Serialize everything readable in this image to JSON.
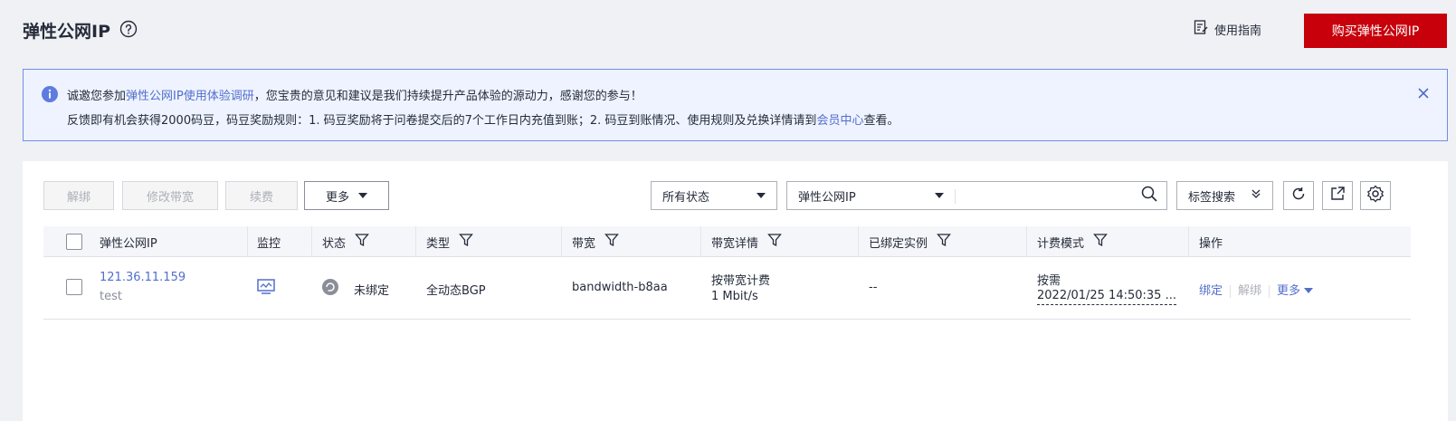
{
  "header": {
    "title": "弹性公网IP",
    "guide_label": "使用指南",
    "buy_label": "购买弹性公网IP"
  },
  "notice": {
    "line1_prefix": "诚邀您参加",
    "line1_link": "弹性公网IP使用体验调研",
    "line1_suffix": "，您宝贵的意见和建议是我们持续提升产品体验的源动力，感谢您的参与！",
    "line2_prefix": "反馈即有机会获得2000码豆，码豆奖励规则：1. 码豆奖励将于问卷提交后的7个工作日内充值到账；2. 码豆到账情况、使用规则及兑换详情请到",
    "line2_link": "会员中心",
    "line2_suffix": "查看。"
  },
  "toolbar": {
    "unbind": "解绑",
    "modify_bandwidth": "修改带宽",
    "renew": "续费",
    "more": "更多",
    "status_filter": "所有状态",
    "search_field": "弹性公网IP",
    "search_value": "",
    "tag_search": "标签搜索"
  },
  "table": {
    "columns": [
      "弹性公网IP",
      "监控",
      "状态",
      "类型",
      "带宽",
      "带宽详情",
      "已绑定实例",
      "计费模式",
      "操作"
    ],
    "rows": [
      {
        "ip": "121.36.11.159",
        "name": "test",
        "status": "未绑定",
        "type": "全动态BGP",
        "bandwidth": "bandwidth-b8aa",
        "bw_billing": "按带宽计费",
        "bw_size": "1 Mbit/s",
        "instance": "--",
        "billing_mode": "按需",
        "billing_time": "2022/01/25 14:50:35 ...",
        "op_bind": "绑定",
        "op_unbind": "解绑",
        "op_more": "更多"
      }
    ]
  },
  "colors": {
    "brand_red": "#c7000b",
    "link_blue": "#526ecc",
    "notice_border": "#6f8dec"
  }
}
